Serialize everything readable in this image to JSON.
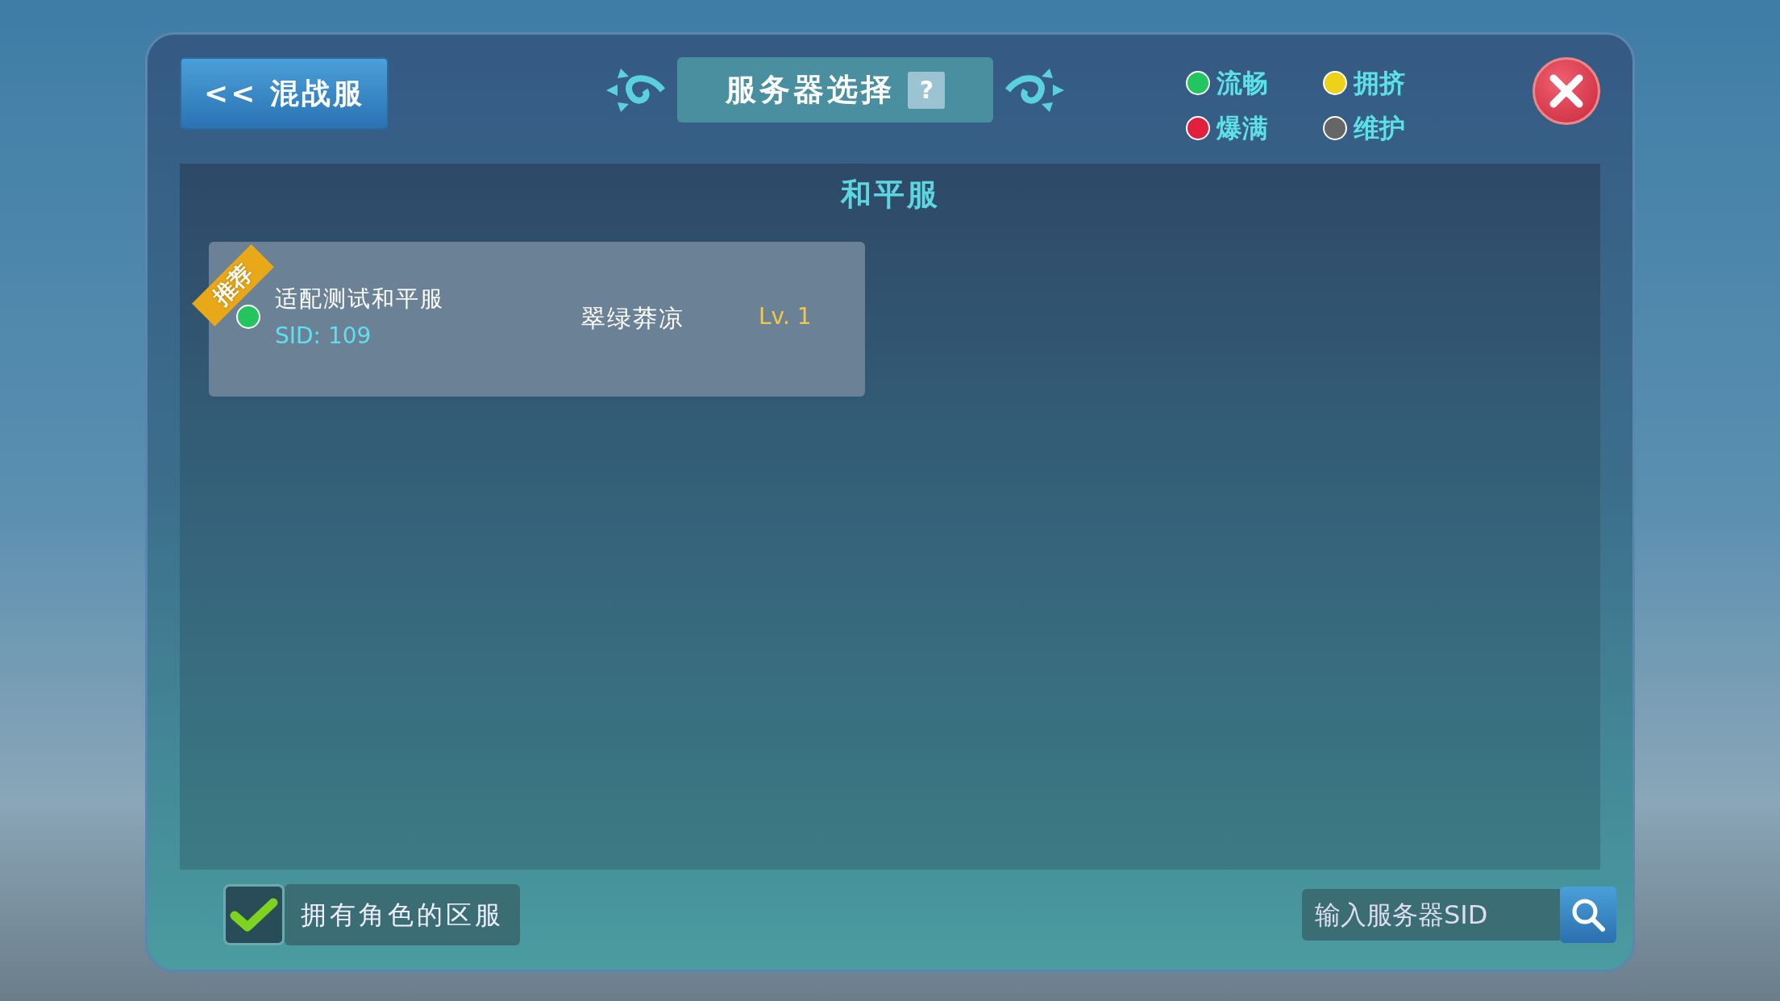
{
  "back_button": {
    "label": "<< 混战服"
  },
  "title": {
    "text": "服务器选择",
    "help": "?"
  },
  "legend": [
    {
      "label": "流畅",
      "color": "#22c55e"
    },
    {
      "label": "拥挤",
      "color": "#eed21a"
    },
    {
      "label": "爆满",
      "color": "#e0203c"
    },
    {
      "label": "维护",
      "color": "#666666"
    }
  ],
  "section": {
    "title": "和平服"
  },
  "servers": [
    {
      "name": "适配测试和平服",
      "sid": "SID: 109",
      "zone": "翠绿莽凉",
      "level": "Lv. 1",
      "badge": "推荐",
      "color": "#22c55e"
    }
  ],
  "filter": {
    "label": "拥有角色的区服",
    "checked": true
  },
  "search": {
    "placeholder": "输入服务器SID"
  }
}
